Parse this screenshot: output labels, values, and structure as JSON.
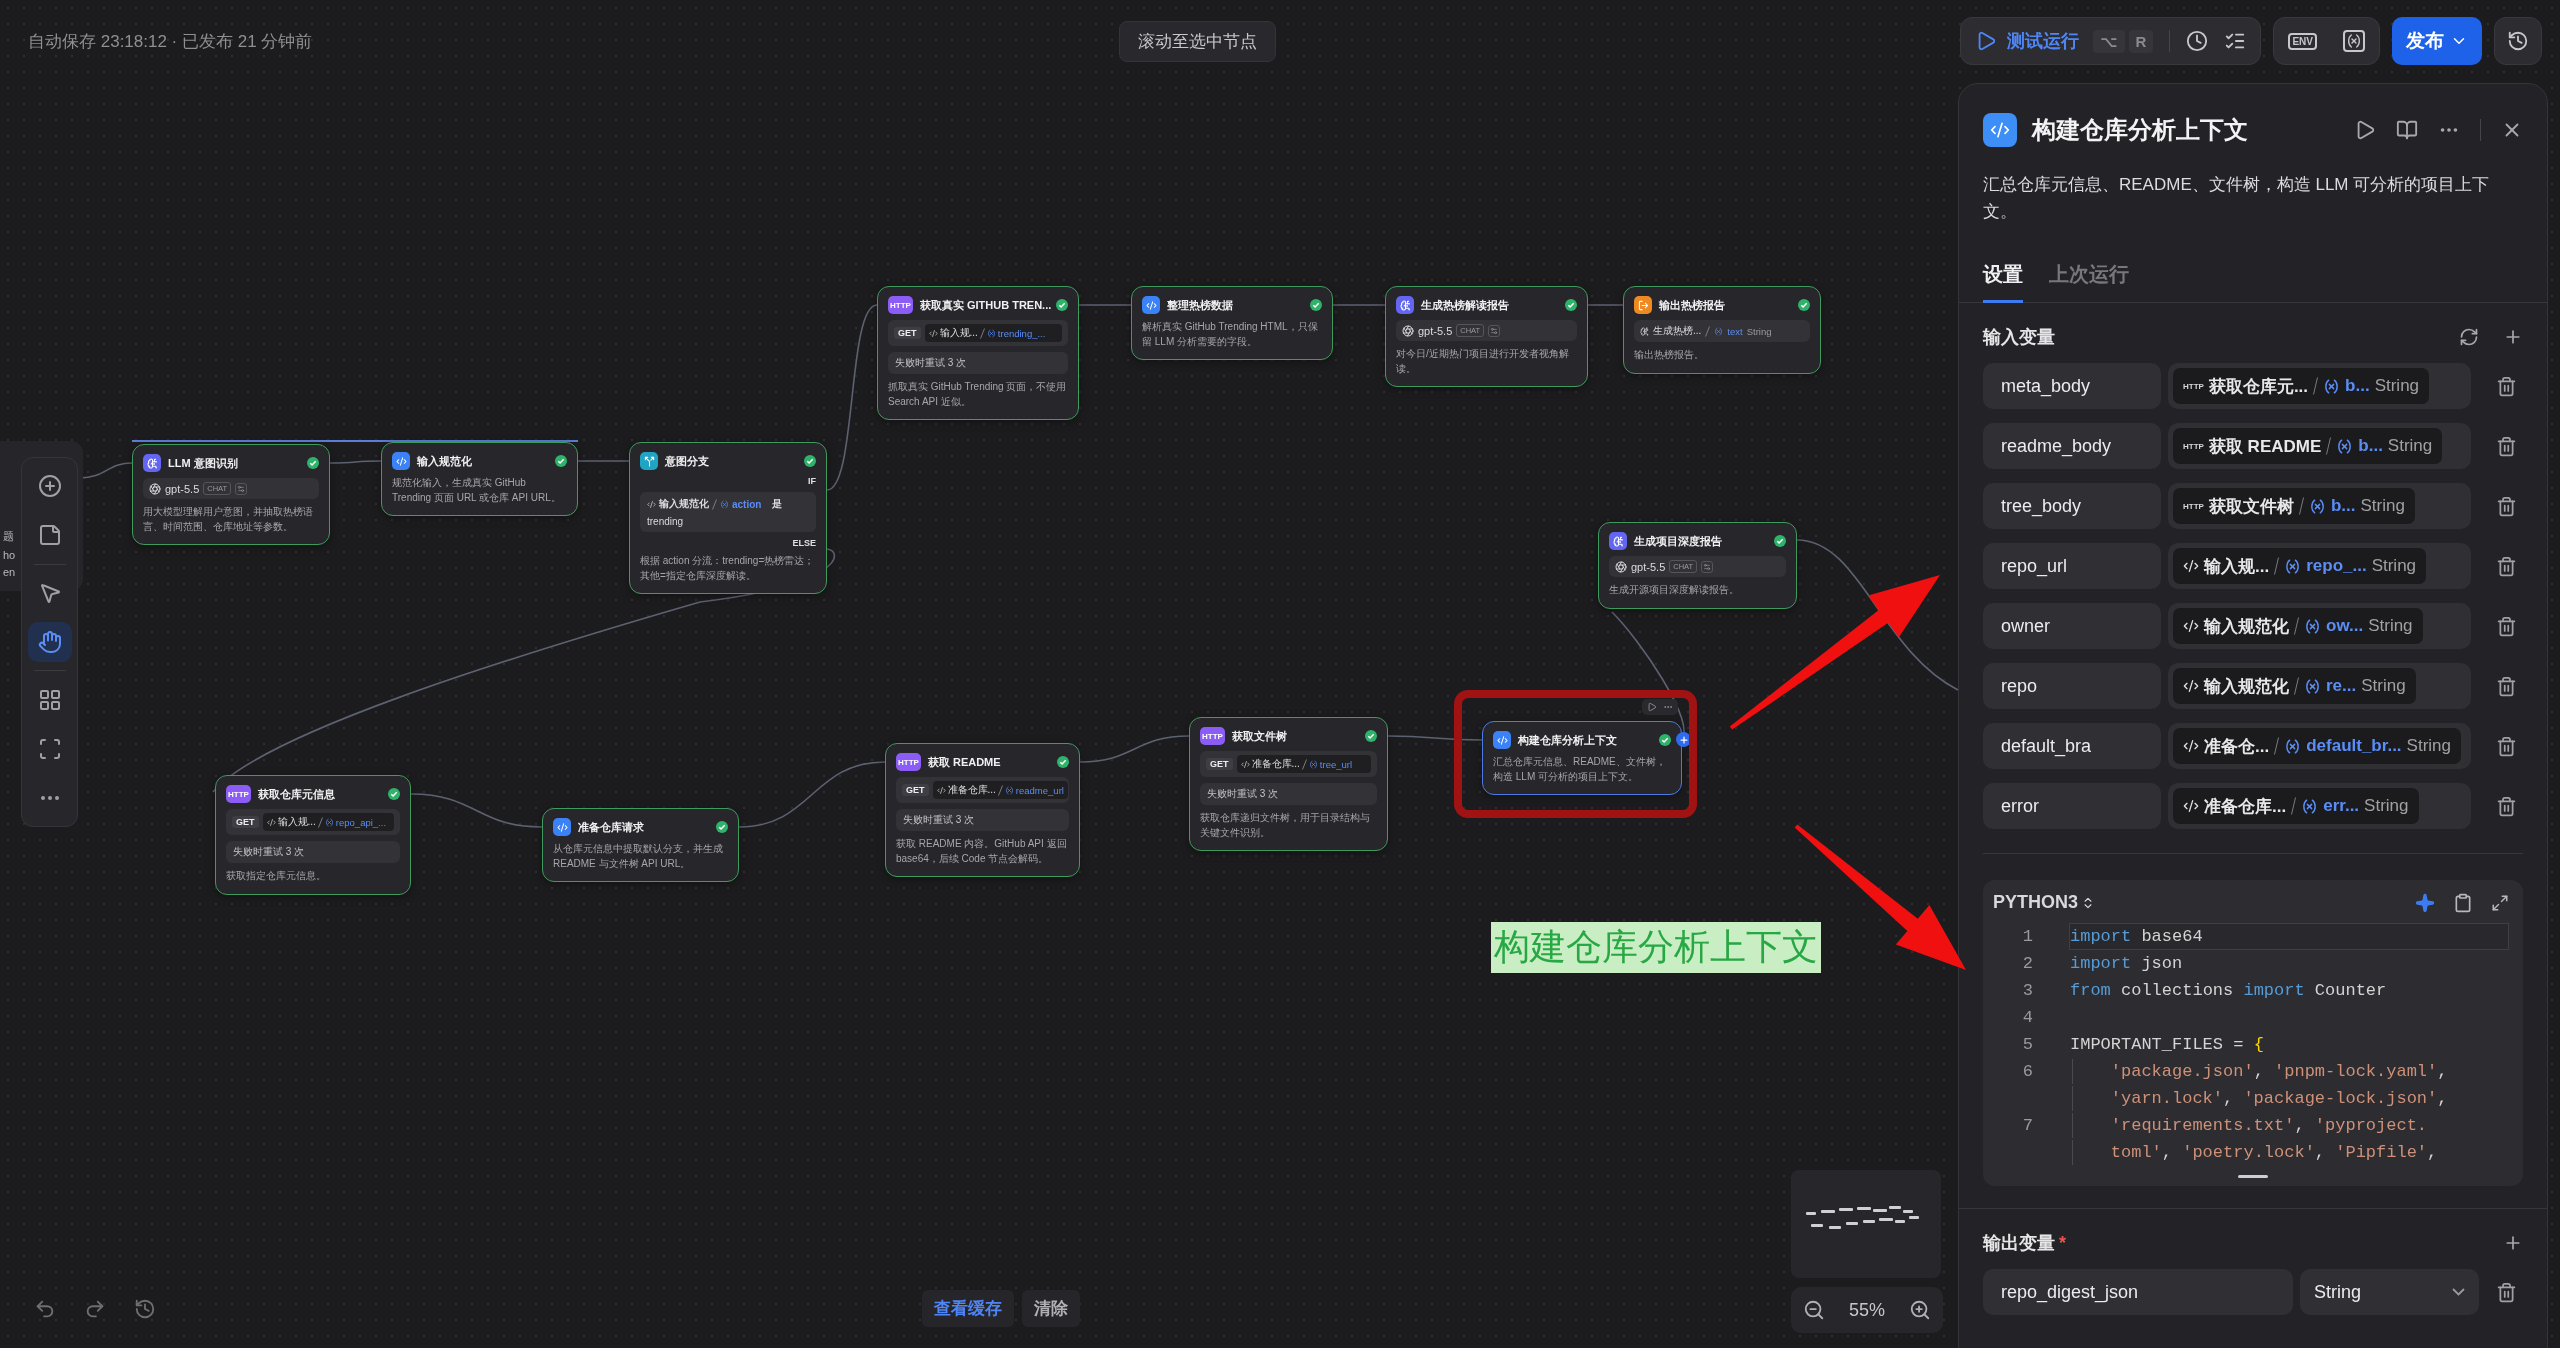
{
  "top_bar": {
    "save_status": "自动保存 23:18:12 · 已发布 21 分钟前",
    "scroll_to_selected": "滚动至选中节点",
    "test_run": "测试运行",
    "shortcut_keys": [
      "⌥",
      "R"
    ],
    "env": "ENV",
    "publish": "发布"
  },
  "left_panel_fragment": [
    "题",
    "ho",
    "en"
  ],
  "left_toolbar": [
    {
      "kind": "add",
      "selected": false
    },
    {
      "kind": "note",
      "selected": false
    },
    {
      "kind": "pointer",
      "selected": false
    },
    {
      "kind": "hand",
      "selected": true
    },
    {
      "kind": "blocks",
      "selected": false
    },
    {
      "kind": "frame",
      "selected": false
    },
    {
      "kind": "more",
      "selected": false
    }
  ],
  "canvas": {
    "nodes": [
      {
        "kind": "llm",
        "title": "LLM 意图识别",
        "selected": false,
        "succeeded": true,
        "model": {
          "name": "gpt-5.5",
          "mode": "CHAT"
        },
        "description": "用大模型理解用户意图，并抽取热榜语言、时间范围、仓库地址等参数。"
      },
      {
        "kind": "code",
        "title": "输入规范化",
        "selected": false,
        "succeeded": true,
        "description": "规范化输入，生成真实 GitHub Trending 页面 URL 或仓库 API URL。"
      },
      {
        "kind": "branch",
        "title": "意图分支",
        "selected": false,
        "succeeded": true,
        "condition": {
          "if_label": "IF",
          "source": "输入规范化",
          "variable": "action",
          "operator": "是",
          "value": "trending",
          "else_label": "ELSE"
        },
        "description": "根据 action 分流：trending=热榜雷达；其他=指定仓库深度解读。"
      },
      {
        "kind": "http",
        "icon_text": "HTTP",
        "title": "获取真实 GITHUB TREN...",
        "selected": false,
        "succeeded": true,
        "request": {
          "method": "GET",
          "source": "输入规...",
          "variable": "trending_..."
        },
        "retry": "失败时重试 3 次",
        "description": "抓取真实 GitHub Trending 页面，不使用 Search API 近似。"
      },
      {
        "kind": "code",
        "title": "整理热榜数据",
        "selected": false,
        "succeeded": true,
        "description": "解析真实 GitHub Trending HTML，只保留 LLM 分析需要的字段。"
      },
      {
        "kind": "llm",
        "title": "生成热榜解读报告",
        "selected": false,
        "succeeded": true,
        "model": {
          "name": "gpt-5.5",
          "mode": "CHAT"
        },
        "description": "对今日/近期热门项目进行开发者视角解读。"
      },
      {
        "kind": "output",
        "title": "输出热榜报告",
        "selected": false,
        "succeeded": true,
        "output": {
          "source": "生成热榜...",
          "variable": "text",
          "type": "String"
        },
        "description": "输出热榜报告。"
      },
      {
        "kind": "llm",
        "title": "生成项目深度报告",
        "selected": false,
        "succeeded": true,
        "model": {
          "name": "gpt-5.5",
          "mode": "CHAT"
        },
        "description": "生成开源项目深度解读报告。"
      },
      {
        "kind": "code",
        "title": "构建仓库分析上下文",
        "selected": true,
        "succeeded": true,
        "description": "汇总仓库元信息、README、文件树，构造 LLM 可分析的项目上下文。"
      },
      {
        "kind": "http",
        "icon_text": "HTTP",
        "title": "获取仓库元信息",
        "selected": false,
        "succeeded": true,
        "request": {
          "method": "GET",
          "source": "输入规...",
          "variable": "repo_api_..."
        },
        "retry": "失败时重试 3 次",
        "description": "获取指定仓库元信息。"
      },
      {
        "kind": "code",
        "title": "准备仓库请求",
        "selected": false,
        "succeeded": true,
        "description": "从仓库元信息中提取默认分支，并生成 README 与文件树 API URL。"
      },
      {
        "kind": "http",
        "icon_text": "HTTP",
        "title": "获取 README",
        "selected": false,
        "succeeded": true,
        "request": {
          "method": "GET",
          "source": "准备仓库...",
          "variable": "readme_url"
        },
        "retry": "失败时重试 3 次",
        "description": "获取 README 内容。GitHub API 返回 base64，后续 Code 节点会解码。"
      },
      {
        "kind": "http",
        "icon_text": "HTTP",
        "title": "获取文件树",
        "selected": false,
        "succeeded": true,
        "request": {
          "method": "GET",
          "source": "准备仓库...",
          "variable": "tree_url"
        },
        "retry": "失败时重试 3 次",
        "description": "获取仓库递归文件树，用于目录结构与关键文件识别。"
      }
    ]
  },
  "annotation": {
    "caption": "构建仓库分析上下文"
  },
  "bottom_bar": {
    "view_cache": "查看缓存",
    "clear": "清除",
    "zoom": "55%"
  },
  "panel": {
    "title": "构建仓库分析上下文",
    "description": "汇总仓库元信息、README、文件树，构造 LLM 可分析的项目上下文。",
    "tabs": [
      {
        "label": "设置",
        "selected": true
      },
      {
        "label": "上次运行",
        "selected": false
      }
    ],
    "inputs_title": "输入变量",
    "inputs": [
      {
        "name": "meta_body",
        "kind": "http",
        "badge": "HTTP",
        "source": "获取仓库元...",
        "variable": "b...",
        "type": "String"
      },
      {
        "name": "readme_body",
        "kind": "http",
        "badge": "HTTP",
        "source": "获取 README",
        "variable": "b...",
        "type": "String"
      },
      {
        "name": "tree_body",
        "kind": "http",
        "badge": "HTTP",
        "source": "获取文件树",
        "variable": "b...",
        "type": "String"
      },
      {
        "name": "repo_url",
        "kind": "code",
        "source": "输入规...",
        "variable": "repo_...",
        "type": "String"
      },
      {
        "name": "owner",
        "kind": "code",
        "source": "输入规范化",
        "variable": "ow...",
        "type": "String"
      },
      {
        "name": "repo",
        "kind": "code",
        "source": "输入规范化",
        "variable": "re...",
        "type": "String"
      },
      {
        "name": "default_bra",
        "kind": "code",
        "source": "准备仓...",
        "variable": "default_br...",
        "type": "String"
      },
      {
        "name": "error",
        "kind": "code",
        "source": "准备仓库...",
        "variable": "err...",
        "type": "String"
      }
    ],
    "language": "PYTHON3",
    "code": [
      {
        "number": "1",
        "current": true,
        "tokens": [
          {
            "kind": "keyword",
            "text": "import"
          },
          {
            "kind": "plain",
            "text": " base64"
          }
        ]
      },
      {
        "number": "2",
        "current": false,
        "tokens": [
          {
            "kind": "keyword",
            "text": "import"
          },
          {
            "kind": "plain",
            "text": " json"
          }
        ]
      },
      {
        "number": "3",
        "current": false,
        "tokens": [
          {
            "kind": "keyword",
            "text": "from"
          },
          {
            "kind": "plain",
            "text": " collections "
          },
          {
            "kind": "keyword",
            "text": "import"
          },
          {
            "kind": "plain",
            "text": " Counter"
          }
        ]
      },
      {
        "number": "4",
        "current": false
      },
      {
        "number": "5",
        "current": false,
        "tokens": [
          {
            "kind": "plain",
            "text": "IMPORTANT_FILES = "
          },
          {
            "kind": "bracket",
            "text": "{"
          }
        ]
      },
      {
        "number": "6",
        "current": false,
        "indented": true,
        "tokens": [
          {
            "kind": "string",
            "text": "'package.json'"
          },
          {
            "kind": "plain",
            "text": ", "
          },
          {
            "kind": "string",
            "text": "'pnpm-lock.yaml'"
          },
          {
            "kind": "plain",
            "text": ","
          }
        ]
      },
      {
        "current": false,
        "indented": true,
        "tokens": [
          {
            "kind": "string",
            "text": "'yarn.lock'"
          },
          {
            "kind": "plain",
            "text": ", "
          },
          {
            "kind": "string",
            "text": "'package-lock.json'"
          },
          {
            "kind": "plain",
            "text": ","
          }
        ]
      },
      {
        "number": "7",
        "current": false,
        "indented": true,
        "tokens": [
          {
            "kind": "string",
            "text": "'requirements.txt'"
          },
          {
            "kind": "plain",
            "text": ", "
          },
          {
            "kind": "string",
            "text": "'pyproject."
          }
        ]
      },
      {
        "current": false,
        "indented": true,
        "tokens": [
          {
            "kind": "string",
            "text": "toml'"
          },
          {
            "kind": "plain",
            "text": ", "
          },
          {
            "kind": "string",
            "text": "'poetry.lock'"
          },
          {
            "kind": "plain",
            "text": ", "
          },
          {
            "kind": "string",
            "text": "'Pipfile'"
          },
          {
            "kind": "plain",
            "text": ","
          }
        ]
      }
    ],
    "outputs_title": "输出变量",
    "outputs_required": "*",
    "outputs": [
      {
        "name": "repo_digest_json",
        "type": "String"
      }
    ]
  }
}
